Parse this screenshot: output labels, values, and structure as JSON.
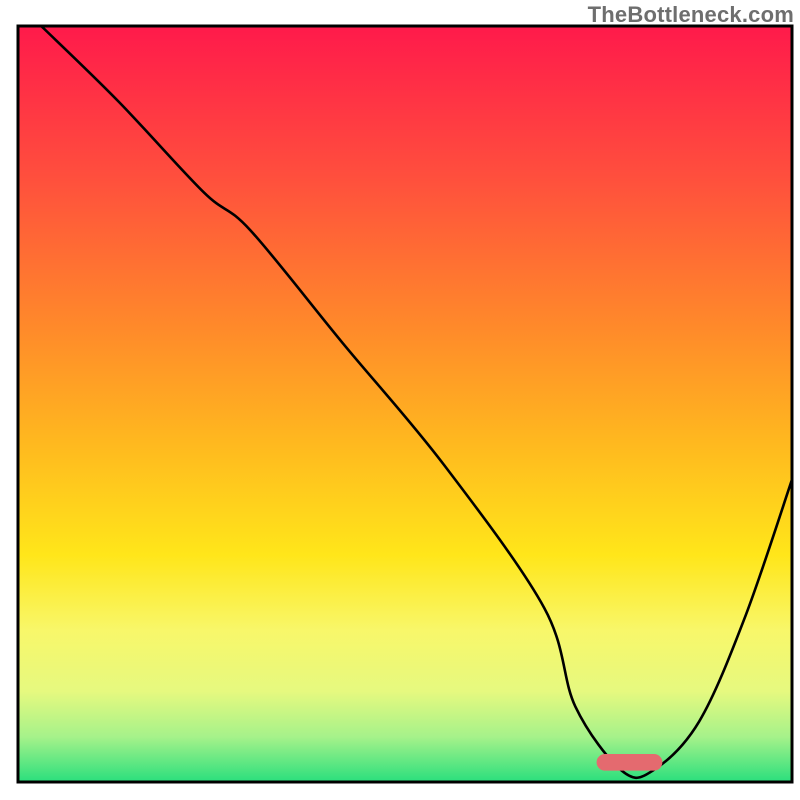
{
  "watermark": "TheBottleneck.com",
  "chart_data": {
    "type": "line",
    "title": "",
    "xlabel": "",
    "ylabel": "",
    "xlim": [
      0,
      100
    ],
    "ylim": [
      0,
      100
    ],
    "grid": false,
    "legend": false,
    "axes_visible": false,
    "background_gradient": {
      "direction": "vertical",
      "stops": [
        {
          "pos": 0.0,
          "color": "#ff1a4b"
        },
        {
          "pos": 0.2,
          "color": "#ff4f3d"
        },
        {
          "pos": 0.4,
          "color": "#ff8a2a"
        },
        {
          "pos": 0.55,
          "color": "#ffb81f"
        },
        {
          "pos": 0.7,
          "color": "#ffe61a"
        },
        {
          "pos": 0.8,
          "color": "#f8f76a"
        },
        {
          "pos": 0.88,
          "color": "#e6f97f"
        },
        {
          "pos": 0.94,
          "color": "#a6f28a"
        },
        {
          "pos": 1.0,
          "color": "#2adf7d"
        }
      ]
    },
    "series": [
      {
        "name": "bottleneck-curve",
        "color": "#000000",
        "stroke_width": 2.6,
        "x": [
          3,
          13,
          24,
          30,
          42,
          55,
          68,
          72,
          78,
          82,
          88,
          94,
          100
        ],
        "y": [
          100,
          90,
          78,
          73,
          58,
          42,
          23,
          10,
          1.5,
          1.5,
          8,
          22,
          40
        ]
      }
    ],
    "marker": {
      "name": "optimal-range",
      "shape": "capsule",
      "color": "#e46a6f",
      "x_center": 79,
      "y_center": 2.6,
      "width": 8.5,
      "height": 2.2
    },
    "frame": {
      "color": "#000000",
      "stroke_width": 3,
      "inset_left": 18,
      "inset_top": 26,
      "inset_right": 8,
      "inset_bottom": 18
    }
  }
}
